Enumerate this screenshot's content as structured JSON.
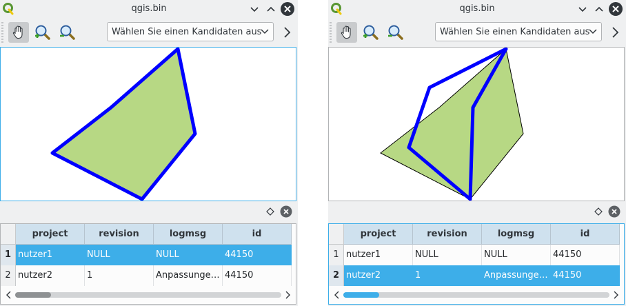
{
  "colors": {
    "polygon_fill": "#b7d884",
    "selected_outline": "#0000ff",
    "selection": "#3daee9",
    "header_bg": "#cfe1ee"
  },
  "windows": [
    {
      "title": "qgis.bin",
      "app_icon": "qgis-icon",
      "controls": [
        "minimize-icon",
        "maximize-icon",
        "close-icon"
      ],
      "toolbar": {
        "tools": [
          "pan-hand-icon",
          "zoom-in-icon",
          "zoom-out-icon"
        ],
        "active_tool": "pan-hand-icon",
        "candidate_select": "Wählen Sie einen Kandidaten aus",
        "more": "chevron-right-icon"
      },
      "table": {
        "columns": [
          "project",
          "revision",
          "logmsg",
          "id"
        ],
        "rows": [
          {
            "num": "1",
            "project": "nutzer1",
            "revision": "NULL",
            "logmsg": "NULL",
            "id": "44150"
          },
          {
            "num": "2",
            "project": "nutzer2",
            "revision": "1",
            "logmsg": "Anpassunge…",
            "id": "44150"
          }
        ],
        "selected_row": 1,
        "scroll_position": 0.12
      }
    },
    {
      "title": "qgis.bin",
      "app_icon": "qgis-icon",
      "controls": [
        "minimize-icon",
        "maximize-icon",
        "close-icon"
      ],
      "toolbar": {
        "tools": [
          "pan-hand-icon",
          "zoom-in-icon",
          "zoom-out-icon"
        ],
        "active_tool": "pan-hand-icon",
        "candidate_select": "Wählen Sie einen Kandidaten aus",
        "more": "chevron-right-icon"
      },
      "table": {
        "columns": [
          "project",
          "revision",
          "logmsg",
          "id"
        ],
        "rows": [
          {
            "num": "1",
            "project": "nutzer1",
            "revision": "NULL",
            "logmsg": "NULL",
            "id": "44150"
          },
          {
            "num": "2",
            "project": "nutzer2",
            "revision": "1",
            "logmsg": "Anpassunge…",
            "id": "44150"
          }
        ],
        "selected_row": 2,
        "scroll_position": 0.12
      }
    }
  ]
}
